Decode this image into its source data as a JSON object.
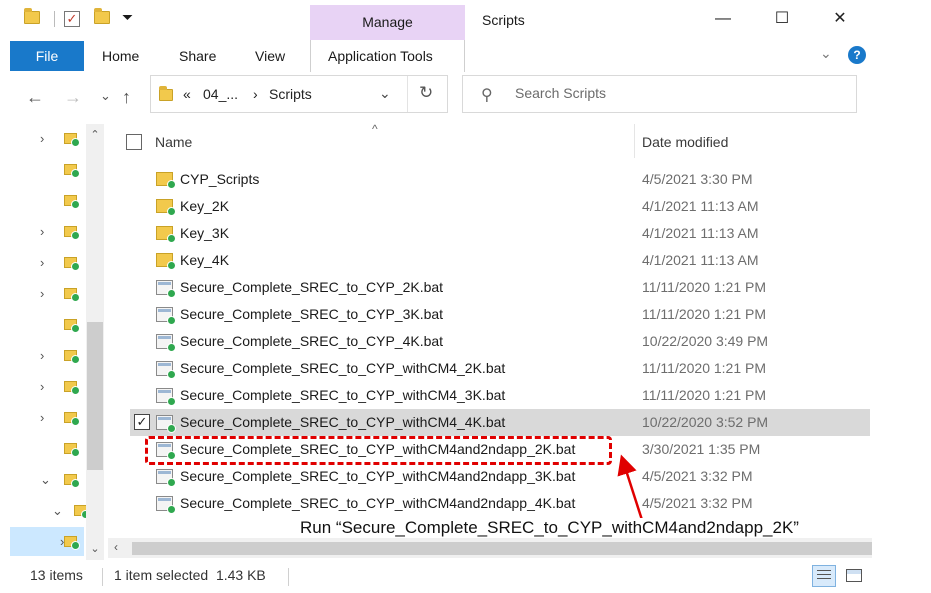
{
  "titlebar": {
    "context_tab": "Manage",
    "window_title": "Scripts",
    "minimize": "—",
    "maximize": "☐",
    "close": "✕"
  },
  "ribbon": {
    "file": "File",
    "home": "Home",
    "share": "Share",
    "view": "View",
    "app_tools": "Application Tools",
    "collapse": "⌄",
    "help": "?"
  },
  "address": {
    "back": "←",
    "forward": "→",
    "recent": "⌄",
    "up": "↑",
    "overflow": "«",
    "crumb1": "04_...",
    "sep": "›",
    "crumb2": "Scripts",
    "dropdown": "⌄",
    "refresh": "↻"
  },
  "search": {
    "icon": "⚲",
    "placeholder": "Search Scripts"
  },
  "nav_pane": {
    "rows": [
      {
        "chevron": "›"
      },
      {
        "chevron": ""
      },
      {
        "chevron": ""
      },
      {
        "chevron": "›"
      },
      {
        "chevron": "›"
      },
      {
        "chevron": "›"
      },
      {
        "chevron": ""
      },
      {
        "chevron": "›"
      },
      {
        "chevron": "›"
      },
      {
        "chevron": "›"
      },
      {
        "chevron": ""
      },
      {
        "chevron": "⌄"
      },
      {
        "chevron": "⌄"
      },
      {
        "chevron": "›"
      }
    ],
    "scroll_up": "⌃",
    "scroll_down": "⌄"
  },
  "list": {
    "col_name": "Name",
    "col_date": "Date modified",
    "sort_indicator": "^",
    "rows": [
      {
        "name": "CYP_Scripts",
        "date": "4/5/2021 3:30 PM",
        "kind": "folder",
        "selected": false
      },
      {
        "name": "Key_2K",
        "date": "4/1/2021 11:13 AM",
        "kind": "folder",
        "selected": false
      },
      {
        "name": "Key_3K",
        "date": "4/1/2021 11:13 AM",
        "kind": "folder",
        "selected": false
      },
      {
        "name": "Key_4K",
        "date": "4/1/2021 11:13 AM",
        "kind": "folder",
        "selected": false
      },
      {
        "name": "Secure_Complete_SREC_to_CYP_2K.bat",
        "date": "11/11/2020 1:21 PM",
        "kind": "bat",
        "selected": false
      },
      {
        "name": "Secure_Complete_SREC_to_CYP_3K.bat",
        "date": "11/11/2020 1:21 PM",
        "kind": "bat",
        "selected": false
      },
      {
        "name": "Secure_Complete_SREC_to_CYP_4K.bat",
        "date": "10/22/2020 3:49 PM",
        "kind": "bat",
        "selected": false
      },
      {
        "name": "Secure_Complete_SREC_to_CYP_withCM4_2K.bat",
        "date": "11/11/2020 1:21 PM",
        "kind": "bat",
        "selected": false
      },
      {
        "name": "Secure_Complete_SREC_to_CYP_withCM4_3K.bat",
        "date": "11/11/2020 1:21 PM",
        "kind": "bat",
        "selected": false
      },
      {
        "name": "Secure_Complete_SREC_to_CYP_withCM4_4K.bat",
        "date": "10/22/2020 3:52 PM",
        "kind": "bat",
        "selected": true
      },
      {
        "name": "Secure_Complete_SREC_to_CYP_withCM4and2ndapp_2K.bat",
        "date": "3/30/2021 1:35 PM",
        "kind": "bat",
        "selected": false
      },
      {
        "name": "Secure_Complete_SREC_to_CYP_withCM4and2ndapp_3K.bat",
        "date": "4/5/2021 3:32 PM",
        "kind": "bat",
        "selected": false
      },
      {
        "name": "Secure_Complete_SREC_to_CYP_withCM4and2ndapp_4K.bat",
        "date": "4/5/2021 3:32 PM",
        "kind": "bat",
        "selected": false
      }
    ],
    "check_mark": "✓",
    "scroll_left": "‹"
  },
  "status": {
    "item_count": "13 items",
    "selection": "1 item selected  1.43 KB"
  },
  "annotation": {
    "text": "Run “Secure_Complete_SREC_to_CYP_withCM4and2ndapp_2K”",
    "color": "#e00000"
  },
  "colors": {
    "accent": "#1979ca",
    "manage_band": "#e8d3f5",
    "selected_row": "#d9d9d9",
    "nav_selected": "#cce8ff"
  }
}
